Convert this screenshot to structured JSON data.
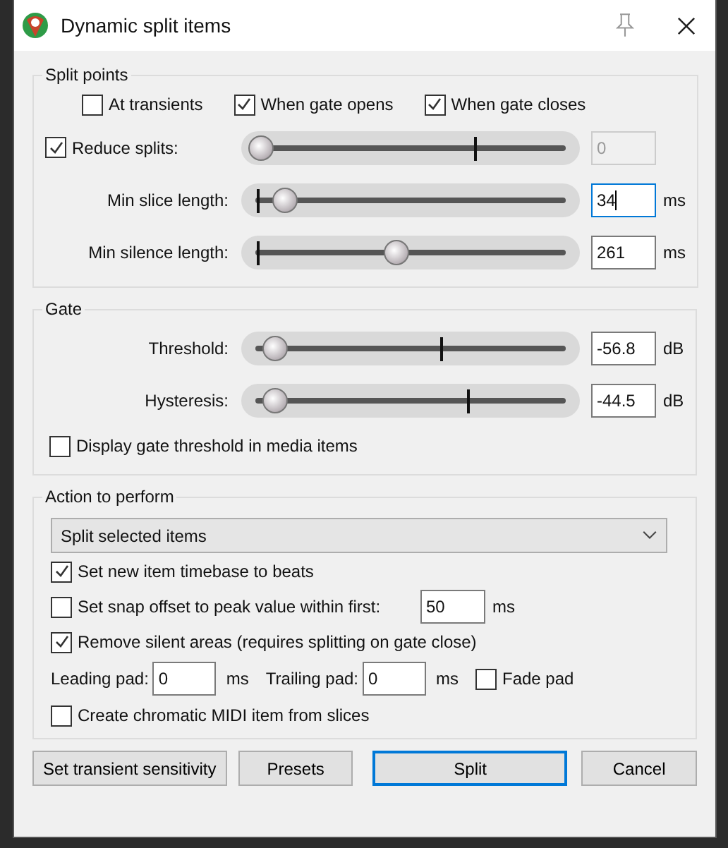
{
  "window": {
    "title": "Dynamic split items"
  },
  "split_points": {
    "title": "Split points",
    "checkboxes": [
      {
        "label": "At transients",
        "checked": false
      },
      {
        "label": "When gate opens",
        "checked": true
      },
      {
        "label": "When gate closes",
        "checked": true
      }
    ],
    "sliders": [
      {
        "kind": "check",
        "label": "Reduce splits:",
        "checked": true,
        "level": 0.06,
        "default": {
          "level": 0.69
        },
        "value": "0",
        "disabled": true,
        "focused": false
      },
      {
        "kind": "label",
        "label": "Min slice length:",
        "level": 0.13,
        "default": {
          "level": 0.05
        },
        "value": "34",
        "unit": "ms",
        "disabled": false,
        "focused": true
      },
      {
        "kind": "label",
        "label": "Min silence length:",
        "level": 0.46,
        "default": {
          "level": 0.05
        },
        "value": "261",
        "unit": "ms",
        "disabled": false,
        "focused": false
      }
    ]
  },
  "gate": {
    "title": "Gate",
    "sliders": [
      {
        "kind": "label",
        "label": "Threshold:",
        "level": 0.1,
        "default": {
          "level": 0.59
        },
        "value": "-56.8",
        "unit": "dB",
        "disabled": false,
        "focused": false
      },
      {
        "kind": "label",
        "label": "Hysteresis:",
        "level": 0.1,
        "default": {
          "level": 0.67
        },
        "value": "-44.5",
        "unit": "dB",
        "disabled": false,
        "focused": false
      }
    ],
    "checkbox": {
      "label": "Display gate threshold in media items",
      "checked": false
    }
  },
  "action": {
    "title": "Action to perform",
    "dropdown": {
      "value": "Split selected items"
    },
    "options": [
      {
        "kind": "check",
        "label": "Set new item timebase to beats",
        "checked": true
      },
      {
        "kind": "check_field",
        "label": "Set snap offset to peak value within first:",
        "checked": false,
        "value": "50",
        "unit": "ms"
      },
      {
        "kind": "check",
        "label": "Remove silent areas (requires splitting on gate close)",
        "checked": true
      },
      {
        "kind": "pads",
        "leading_label": "Leading pad:",
        "leading_value": "0",
        "leading_unit": "ms",
        "trailing_label": "Trailing pad:",
        "trailing_value": "0",
        "trailing_unit": "ms",
        "fade_label": "Fade pad",
        "checked": false
      },
      {
        "kind": "check",
        "label": "Create chromatic MIDI item from slices",
        "checked": false
      }
    ]
  },
  "buttons": [
    {
      "label": "Set transient sensitivity",
      "default": false
    },
    {
      "label": "Presets",
      "default": false
    },
    {
      "label": "Split",
      "default": true
    },
    {
      "label": "Cancel",
      "default": false
    }
  ]
}
